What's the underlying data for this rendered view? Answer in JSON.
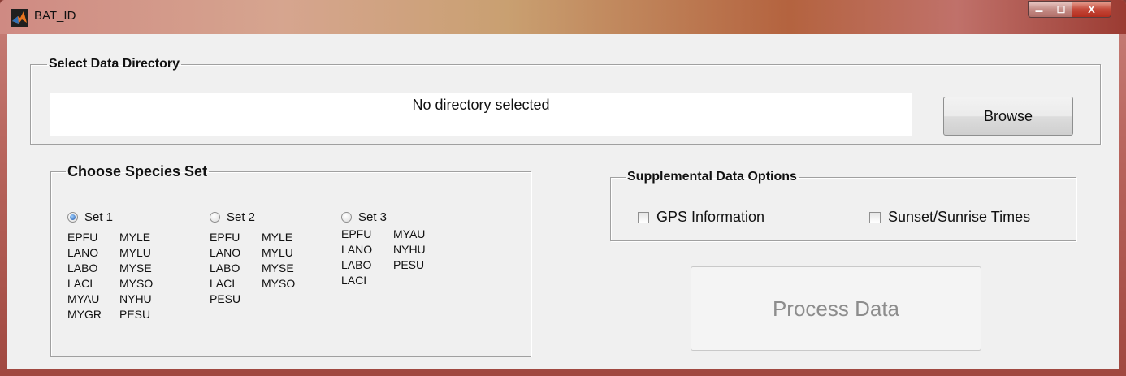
{
  "window": {
    "title": "BAT_ID",
    "controls": {
      "minimize": "▬",
      "maximize": "☐",
      "close": "X"
    }
  },
  "directory": {
    "legend": "Select Data Directory",
    "path_display": "No directory selected",
    "browse_label": "Browse"
  },
  "species": {
    "legend": "Choose Species Set",
    "sets": [
      {
        "label": "Set 1",
        "selected": true,
        "rows": [
          [
            "EPFU",
            "MYLE"
          ],
          [
            "LANO",
            "MYLU"
          ],
          [
            "LABO",
            "MYSE"
          ],
          [
            "LACI",
            "MYSO"
          ],
          [
            "MYAU",
            "NYHU"
          ],
          [
            "MYGR",
            "PESU"
          ]
        ]
      },
      {
        "label": "Set 2",
        "selected": false,
        "rows": [
          [
            "EPFU",
            "MYLE"
          ],
          [
            "LANO",
            "MYLU"
          ],
          [
            "LABO",
            "MYSE"
          ],
          [
            "LACI",
            "MYSO"
          ],
          [
            "PESU",
            ""
          ]
        ]
      },
      {
        "label": "Set 3",
        "selected": false,
        "rows": [
          [
            "EPFU",
            "MYAU"
          ],
          [
            "LANO",
            "NYHU"
          ],
          [
            "LABO",
            "PESU"
          ],
          [
            "LACI",
            ""
          ]
        ]
      }
    ]
  },
  "supplemental": {
    "legend": "Supplemental Data Options",
    "gps_label": "GPS Information",
    "gps_checked": false,
    "sun_label": "Sunset/Sunrise Times",
    "sun_checked": false
  },
  "process": {
    "label": "Process Data",
    "enabled": false
  }
}
